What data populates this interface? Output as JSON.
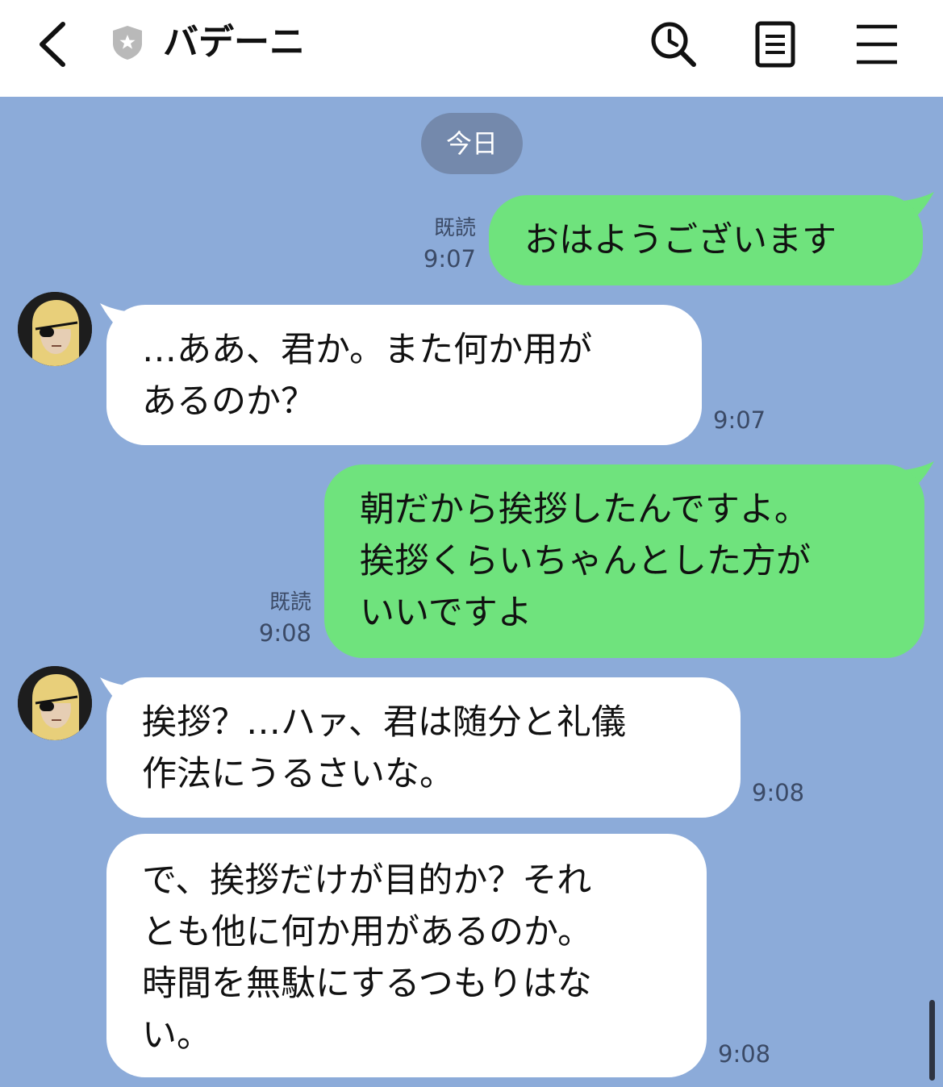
{
  "header": {
    "title": "バデーニ",
    "back_icon": "chevron-left-icon",
    "badge_icon": "shield-star-icon",
    "search_icon": "search-history-icon",
    "notes_icon": "notes-icon",
    "menu_icon": "hamburger-menu-icon"
  },
  "date_label": "今日",
  "colors": {
    "background": "#8CABD9",
    "sent_bubble": "#6FE37D",
    "received_bubble": "#FFFFFF",
    "date_chip": "#7489AC"
  },
  "messages": [
    {
      "direction": "sent",
      "text": "おはようございます",
      "read": "既読",
      "time": "9:07"
    },
    {
      "direction": "received",
      "text": "…ああ、君か。また何か用が\nあるのか？",
      "time": "9:07"
    },
    {
      "direction": "sent",
      "text": "朝だから挨拶したんですよ。\n挨拶くらいちゃんとした方が\nいいですよ",
      "read": "既読",
      "time": "9:08"
    },
    {
      "direction": "received",
      "text": "挨拶？…ハァ、君は随分と礼儀\n作法にうるさいな。",
      "time": "9:08"
    },
    {
      "direction": "received",
      "text": "で、挨拶だけが目的か？それ\nとも他に何か用があるのか。\n時間を無駄にするつもりはな\nい。",
      "time": "9:08"
    }
  ]
}
